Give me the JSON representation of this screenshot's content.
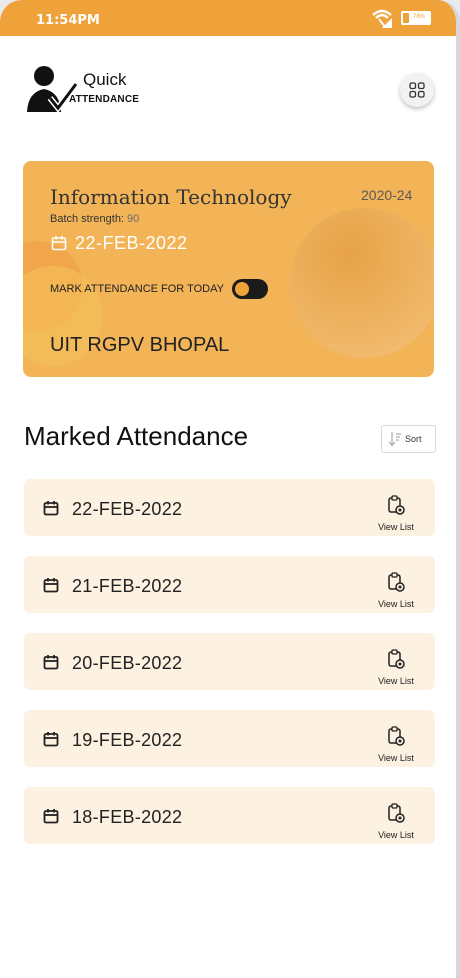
{
  "status_bar": {
    "time": "11:54PM",
    "battery": "78%"
  },
  "header": {
    "logo_line1": "Quick",
    "logo_line2": "ATTENDANCE"
  },
  "card": {
    "subject": "Information Technology",
    "session": "2020-24",
    "batch_label": "Batch strength:",
    "batch_value": "90",
    "date": "22-FEB-2022",
    "mark_label": "MARK ATTENDANCE FOR TODAY",
    "mark_toggle_on": false,
    "institute": "UIT RGPV BHOPAL"
  },
  "marked": {
    "title": "Marked Attendance",
    "sort_label": "Sort",
    "view_label": "View List",
    "entries": [
      "22-FEB-2022",
      "21-FEB-2022",
      "20-FEB-2022",
      "19-FEB-2022",
      "18-FEB-2022"
    ]
  },
  "colors": {
    "accent": "#f0a23a",
    "card": "#f2b457",
    "row_bg": "#fdf1e1"
  }
}
